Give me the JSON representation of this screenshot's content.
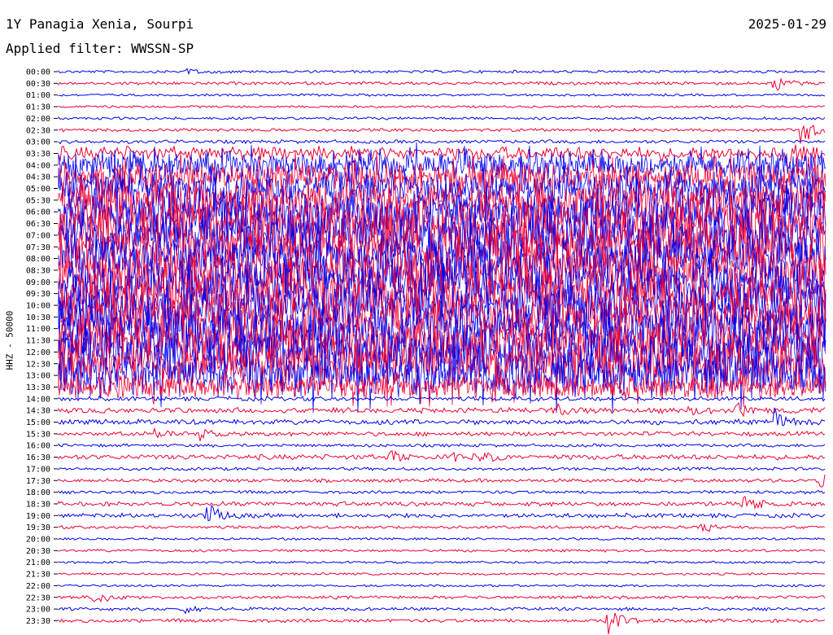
{
  "header": {
    "station": "1Y Panagia Xenia, Sourpi",
    "date": "2025-01-29",
    "filter": "Applied filter: WWSSN-SP"
  },
  "axis": {
    "ylabel": "HHZ - 50000"
  },
  "colors": {
    "even_trace": "#0000ee",
    "odd_trace": "#ee0033",
    "background": "#ffffff"
  },
  "chart_data": {
    "type": "line",
    "title": "",
    "ylabel": "HHZ - 50000",
    "rows": [
      "00:00",
      "00:30",
      "01:00",
      "01:30",
      "02:00",
      "02:30",
      "03:00",
      "03:30",
      "04:00",
      "04:30",
      "05:00",
      "05:30",
      "06:00",
      "06:30",
      "07:00",
      "07:30",
      "08:00",
      "08:30",
      "09:00",
      "09:30",
      "10:00",
      "10:30",
      "11:00",
      "11:30",
      "12:00",
      "12:30",
      "13:00",
      "13:30",
      "14:00",
      "14:30",
      "15:00",
      "15:30",
      "16:00",
      "16:30",
      "17:00",
      "17:30",
      "18:00",
      "18:30",
      "19:00",
      "19:30",
      "20:00",
      "20:30",
      "21:00",
      "21:30",
      "22:00",
      "22:30",
      "23:00",
      "23:30"
    ],
    "activity_level": [
      0.04,
      0.05,
      0.03,
      0.03,
      0.04,
      0.05,
      0.06,
      0.3,
      0.55,
      0.6,
      0.7,
      0.85,
      0.95,
      1.0,
      1.0,
      1.0,
      1.0,
      1.0,
      1.0,
      1.0,
      1.0,
      1.0,
      1.0,
      1.0,
      1.0,
      0.95,
      0.9,
      0.5,
      0.08,
      0.1,
      0.1,
      0.08,
      0.05,
      0.1,
      0.05,
      0.06,
      0.05,
      0.08,
      0.08,
      0.05,
      0.03,
      0.04,
      0.03,
      0.03,
      0.03,
      0.05,
      0.05,
      0.06
    ],
    "events": [
      {
        "row": "00:00",
        "minute": 5.0,
        "amp": 0.5
      },
      {
        "row": "00:30",
        "minute": 28.0,
        "amp": 0.9
      },
      {
        "row": "02:30",
        "minute": 29.0,
        "amp": 1.8
      },
      {
        "row": "03:30",
        "minute": 28.5,
        "amp": 1.5
      },
      {
        "row": "04:00",
        "minute": 29.5,
        "amp": 1.2
      },
      {
        "row": "14:30",
        "minute": 19.5,
        "amp": 0.6
      },
      {
        "row": "14:30",
        "minute": 24.5,
        "amp": 0.7
      },
      {
        "row": "14:30",
        "minute": 26.5,
        "amp": 0.8
      },
      {
        "row": "15:00",
        "minute": 28.0,
        "amp": 1.2
      },
      {
        "row": "15:30",
        "minute": 3.8,
        "amp": 0.6
      },
      {
        "row": "15:30",
        "minute": 5.5,
        "amp": 0.6
      },
      {
        "row": "16:30",
        "minute": 13.0,
        "amp": 0.8
      },
      {
        "row": "16:30",
        "minute": 15.5,
        "amp": 0.6
      },
      {
        "row": "16:30",
        "minute": 16.5,
        "amp": 0.6
      },
      {
        "row": "17:30",
        "minute": 29.7,
        "amp": 0.9
      },
      {
        "row": "18:30",
        "minute": 26.8,
        "amp": 1.0
      },
      {
        "row": "19:00",
        "minute": 5.8,
        "amp": 1.3
      },
      {
        "row": "19:30",
        "minute": 25.2,
        "amp": 0.4
      },
      {
        "row": "22:30",
        "minute": 1.4,
        "amp": 0.8
      },
      {
        "row": "23:00",
        "minute": 4.9,
        "amp": 0.6
      },
      {
        "row": "23:30",
        "minute": 21.5,
        "amp": 1.3
      }
    ]
  }
}
